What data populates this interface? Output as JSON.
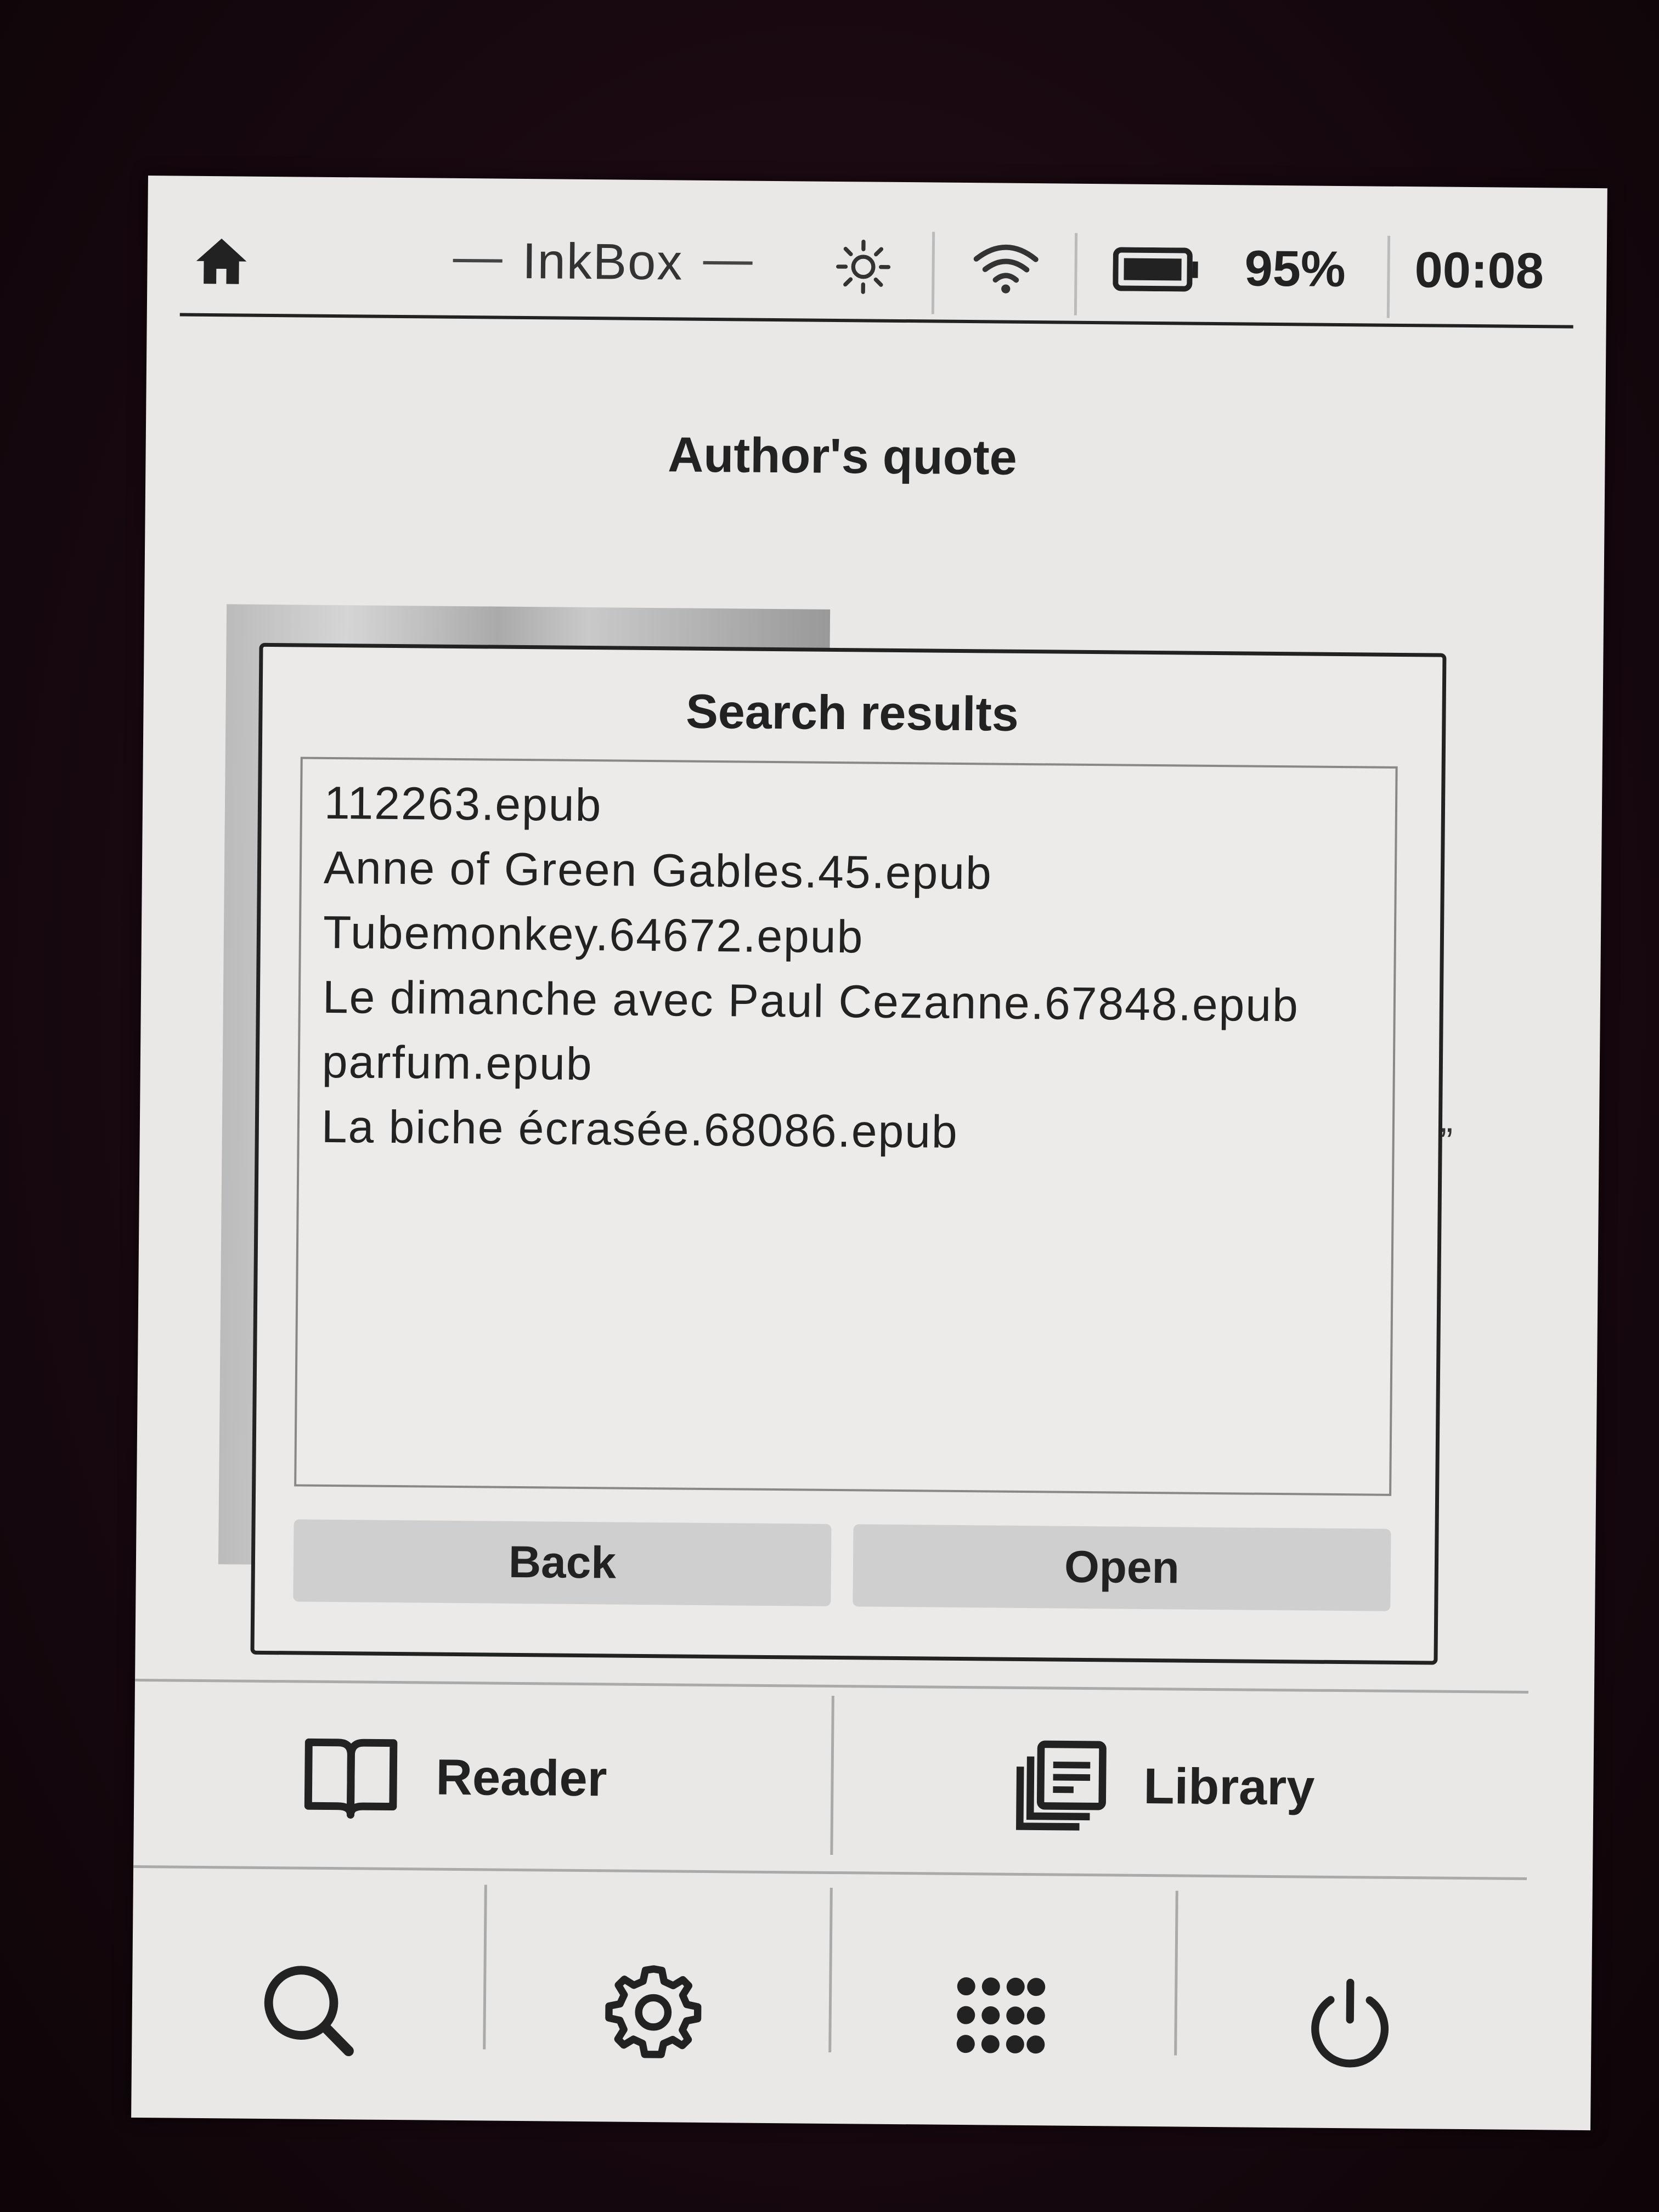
{
  "status_bar": {
    "app_title": "InkBox",
    "battery_percent": "95%",
    "clock": "00:08",
    "icons": [
      "home-icon",
      "brightness-icon",
      "wifi-icon",
      "battery-icon"
    ]
  },
  "page": {
    "heading": "Author's quote"
  },
  "dialog": {
    "title": "Search results",
    "results": [
      "112263.epub",
      "Anne of Green Gables.45.epub",
      "Tubemonkey.64672.epub",
      "Le dimanche avec Paul Cezanne.67848.epub",
      "parfum.epub",
      "La biche écrasée.68086.epub"
    ],
    "back_label": "Back",
    "open_label": "Open"
  },
  "main_actions": {
    "reader_label": "Reader",
    "library_label": "Library"
  },
  "toolbar": {
    "icons": [
      "search-icon",
      "settings-gear-icon",
      "apps-grid-icon",
      "power-icon"
    ]
  }
}
